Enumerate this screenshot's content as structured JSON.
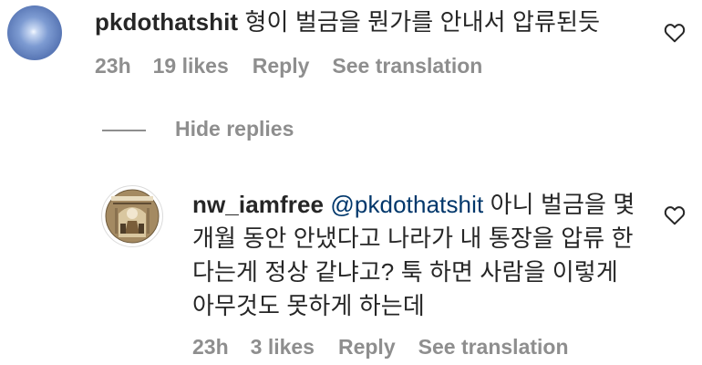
{
  "comment_1": {
    "username": "pkdothatshit",
    "text": "형이 벌금을 뭔가를 안내서 압류된듯",
    "time": "23h",
    "likes": "19 likes",
    "reply_label": "Reply",
    "translate_label": "See translation",
    "avatar_icon": "blue-glow-avatar-icon",
    "like_icon": "heart-outline-icon"
  },
  "replies_toggle": {
    "label": "Hide replies"
  },
  "comment_2": {
    "username": "nw_iamfree",
    "mention": "@pkdothatshit",
    "text": "아니 벌금을 몇개월 동안 안냈다고 나라가 내 통장을 압류 한다는게 정상 같냐고? 툭 하면 사람을 이렇게 아무것도 못하게 하는데",
    "time": "23h",
    "likes": "3 likes",
    "reply_label": "Reply",
    "translate_label": "See translation",
    "avatar_icon": "poster-art-avatar-icon",
    "like_icon": "heart-outline-icon"
  },
  "colors": {
    "text_primary": "#262626",
    "text_secondary": "#8e8e8e",
    "mention": "#00376b",
    "background": "#ffffff"
  }
}
